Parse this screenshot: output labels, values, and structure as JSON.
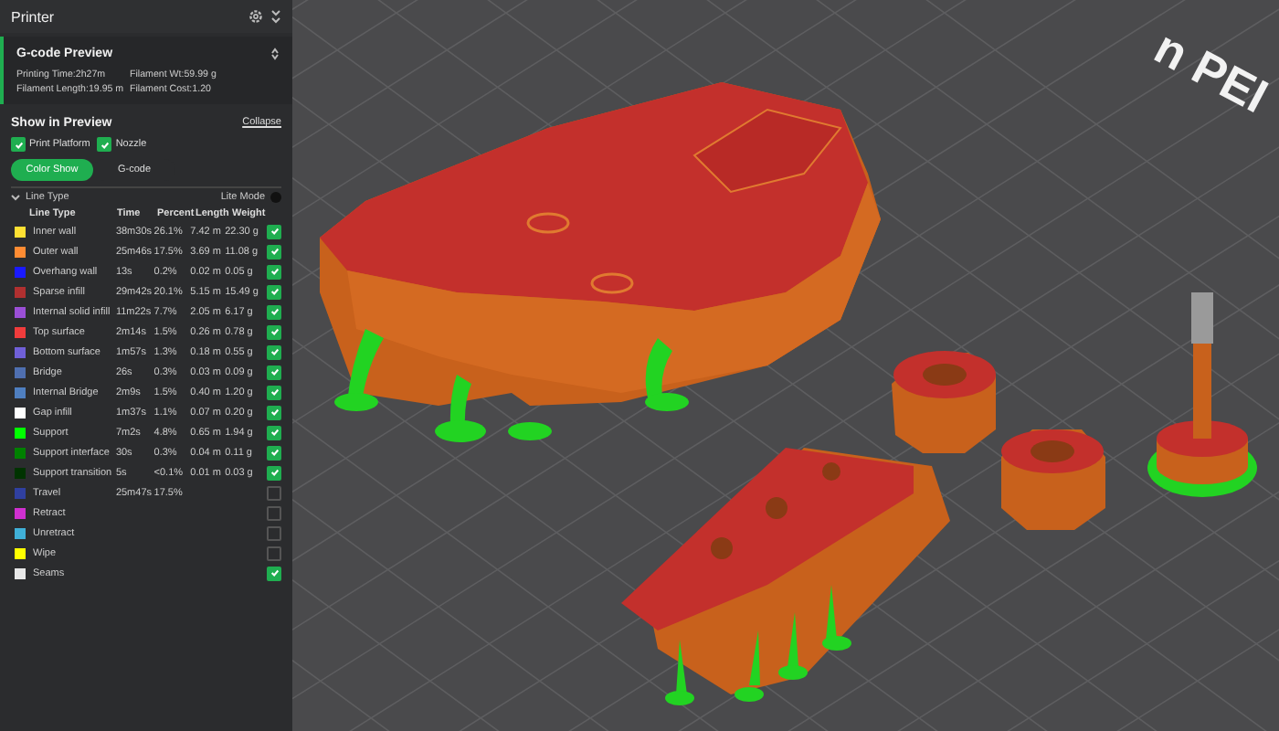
{
  "panel": {
    "title": "Printer"
  },
  "gcode_preview": {
    "title": "G-code Preview",
    "stats": [
      "Printing Time:2h27m",
      "Filament Wt:59.99 g",
      "Filament Length:19.95 m",
      "Filament Cost:1.20"
    ]
  },
  "show_in_preview": {
    "title": "Show in Preview",
    "collapse_link": "Collapse",
    "options": [
      {
        "label": "Print Platform",
        "checked": true
      },
      {
        "label": "Nozzle",
        "checked": true
      }
    ]
  },
  "view_tabs": [
    {
      "label": "Color Show",
      "selected": true
    },
    {
      "label": "G-code",
      "selected": false
    }
  ],
  "line_type_dropdown": {
    "label": "Line Type",
    "lite_mode_label": "Lite Mode",
    "lite_mode_on": false
  },
  "table": {
    "columns": [
      "Line Type",
      "Time",
      "Percent",
      "Length",
      "Weight"
    ],
    "rows": [
      {
        "name": "Inner wall",
        "color": "#ffe033",
        "time": "38m30s",
        "percent": "26.1%",
        "length": "7.42 m",
        "weight": "22.30 g",
        "visible": true
      },
      {
        "name": "Outer wall",
        "color": "#ff8c33",
        "time": "25m46s",
        "percent": "17.5%",
        "length": "3.69 m",
        "weight": "11.08 g",
        "visible": true
      },
      {
        "name": "Overhang wall",
        "color": "#1a1aff",
        "time": "13s",
        "percent": "0.2%",
        "length": "0.02 m",
        "weight": "0.05 g",
        "visible": true
      },
      {
        "name": "Sparse infill",
        "color": "#b03030",
        "time": "29m42s",
        "percent": "20.1%",
        "length": "5.15 m",
        "weight": "15.49 g",
        "visible": true
      },
      {
        "name": "Internal solid infill",
        "color": "#9a4fd6",
        "time": "11m22s",
        "percent": "7.7%",
        "length": "2.05 m",
        "weight": "6.17 g",
        "visible": true
      },
      {
        "name": "Top surface",
        "color": "#f03c3c",
        "time": "2m14s",
        "percent": "1.5%",
        "length": "0.26 m",
        "weight": "0.78 g",
        "visible": true
      },
      {
        "name": "Bottom surface",
        "color": "#7060d8",
        "time": "1m57s",
        "percent": "1.3%",
        "length": "0.18 m",
        "weight": "0.55 g",
        "visible": true
      },
      {
        "name": "Bridge",
        "color": "#4f6fb0",
        "time": "26s",
        "percent": "0.3%",
        "length": "0.03 m",
        "weight": "0.09 g",
        "visible": true
      },
      {
        "name": "Internal Bridge",
        "color": "#4f7fc0",
        "time": "2m9s",
        "percent": "1.5%",
        "length": "0.40 m",
        "weight": "1.20 g",
        "visible": true
      },
      {
        "name": "Gap infill",
        "color": "#ffffff",
        "time": "1m37s",
        "percent": "1.1%",
        "length": "0.07 m",
        "weight": "0.20 g",
        "visible": true
      },
      {
        "name": "Support",
        "color": "#00ff00",
        "time": "7m2s",
        "percent": "4.8%",
        "length": "0.65 m",
        "weight": "1.94 g",
        "visible": true
      },
      {
        "name": "Support interface",
        "color": "#008000",
        "time": "30s",
        "percent": "0.3%",
        "length": "0.04 m",
        "weight": "0.11 g",
        "visible": true
      },
      {
        "name": "Support transition",
        "color": "#003300",
        "time": "5s",
        "percent": "<0.1%",
        "length": "0.01 m",
        "weight": "0.03 g",
        "visible": true
      },
      {
        "name": "Travel",
        "color": "#3040a0",
        "time": "25m47s",
        "percent": "17.5%",
        "length": "",
        "weight": "",
        "visible": false
      },
      {
        "name": "Retract",
        "color": "#d030d0",
        "time": "",
        "percent": "",
        "length": "",
        "weight": "",
        "visible": false
      },
      {
        "name": "Unretract",
        "color": "#40b0d8",
        "time": "",
        "percent": "",
        "length": "",
        "weight": "",
        "visible": false
      },
      {
        "name": "Wipe",
        "color": "#ffff00",
        "time": "",
        "percent": "",
        "length": "",
        "weight": "",
        "visible": false
      },
      {
        "name": "Seams",
        "color": "#e8e8e8",
        "time": "",
        "percent": "",
        "length": "",
        "weight": "",
        "visible": true
      }
    ]
  },
  "viewport": {
    "bed_label": "n PEI"
  }
}
